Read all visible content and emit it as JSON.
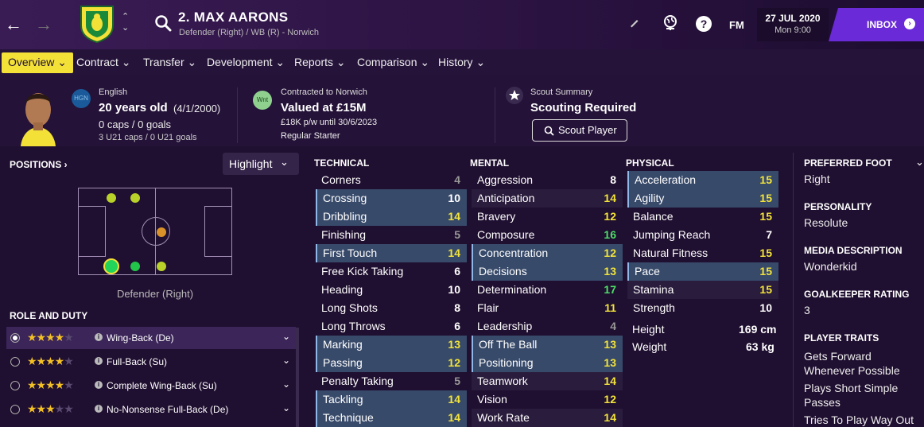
{
  "nav": {
    "back": "←",
    "forward": "→"
  },
  "player": {
    "title": "2. MAX AARONS",
    "subtitle": "Defender (Right) / WB (R) - Norwich"
  },
  "topbar": {
    "fm": "FM",
    "date": "27 JUL 2020",
    "time": "Mon 9:00",
    "inbox": "INBOX"
  },
  "tabs": [
    "Overview",
    "Contract",
    "Transfer",
    "Development",
    "Reports",
    "Comparison",
    "History"
  ],
  "header": {
    "nationality_badge": "HGN",
    "nationality": "English",
    "age": "20 years old",
    "dob": "(4/1/2000)",
    "caps": "0 caps / 0 goals",
    "u21": "3 U21 caps / 0 U21 goals",
    "club_badge": "Wnt",
    "contract_label": "Contracted to Norwich",
    "value": "Valued at £15M",
    "wage": "£18K p/w until 30/6/2023",
    "status": "Regular Starter",
    "scout_label": "Scout Summary",
    "scout_status": "Scouting Required",
    "scout_button": "Scout Player"
  },
  "positions": {
    "heading": "POSITIONS",
    "highlight": "Highlight",
    "label": "Defender (Right)"
  },
  "roles": {
    "heading": "ROLE AND DUTY",
    "items": [
      {
        "name": "Wing-Back (De)",
        "stars": 4
      },
      {
        "name": "Full-Back (Su)",
        "stars": 4
      },
      {
        "name": "Complete Wing-Back (Su)",
        "stars": 4
      },
      {
        "name": "No-Nonsense Full-Back (De)",
        "stars": 3
      }
    ]
  },
  "technical": {
    "heading": "TECHNICAL",
    "rows": [
      [
        "Corners",
        "4"
      ],
      [
        "Crossing",
        "10"
      ],
      [
        "Dribbling",
        "14"
      ],
      [
        "Finishing",
        "5"
      ],
      [
        "First Touch",
        "14"
      ],
      [
        "Free Kick Taking",
        "6"
      ],
      [
        "Heading",
        "10"
      ],
      [
        "Long Shots",
        "8"
      ],
      [
        "Long Throws",
        "6"
      ],
      [
        "Marking",
        "13"
      ],
      [
        "Passing",
        "12"
      ],
      [
        "Penalty Taking",
        "5"
      ],
      [
        "Tackling",
        "14"
      ],
      [
        "Technique",
        "14"
      ]
    ]
  },
  "mental": {
    "heading": "MENTAL",
    "rows": [
      [
        "Aggression",
        "8"
      ],
      [
        "Anticipation",
        "14"
      ],
      [
        "Bravery",
        "12"
      ],
      [
        "Composure",
        "16"
      ],
      [
        "Concentration",
        "12"
      ],
      [
        "Decisions",
        "13"
      ],
      [
        "Determination",
        "17"
      ],
      [
        "Flair",
        "11"
      ],
      [
        "Leadership",
        "4"
      ],
      [
        "Off The Ball",
        "13"
      ],
      [
        "Positioning",
        "13"
      ],
      [
        "Teamwork",
        "14"
      ],
      [
        "Vision",
        "12"
      ],
      [
        "Work Rate",
        "14"
      ]
    ]
  },
  "physical": {
    "heading": "PHYSICAL",
    "rows": [
      [
        "Acceleration",
        "15"
      ],
      [
        "Agility",
        "15"
      ],
      [
        "Balance",
        "15"
      ],
      [
        "Jumping Reach",
        "7"
      ],
      [
        "Natural Fitness",
        "15"
      ],
      [
        "Pace",
        "15"
      ],
      [
        "Stamina",
        "15"
      ],
      [
        "Strength",
        "10"
      ]
    ],
    "height_label": "Height",
    "height": "169 cm",
    "weight_label": "Weight",
    "weight": "63 kg"
  },
  "side": {
    "foot_label": "PREFERRED FOOT",
    "foot": "Right",
    "personality_label": "PERSONALITY",
    "personality": "Resolute",
    "media_label": "MEDIA DESCRIPTION",
    "media": "Wonderkid",
    "gk_label": "GOALKEEPER RATING",
    "gk": "3",
    "traits_label": "PLAYER TRAITS",
    "traits": [
      "Gets Forward Whenever Possible",
      "Plays Short Simple Passes",
      "Tries To Play Way Out Of"
    ]
  },
  "colors": {
    "accent": "#f4e138",
    "inbox": "#6a2ad8",
    "green": "#4de067",
    "yellow": "#f2e33a"
  }
}
